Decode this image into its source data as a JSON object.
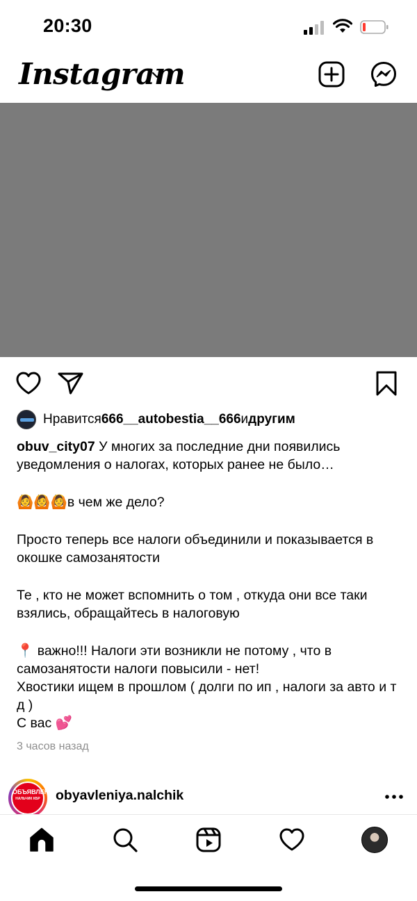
{
  "status_bar": {
    "time": "20:30"
  },
  "header": {
    "logo_text": "Instagram"
  },
  "post": {
    "likes": {
      "prefix": "Нравится ",
      "user": "666__autobestia__666",
      "middle": " и ",
      "suffix": "другим"
    },
    "caption": {
      "username": "obuv_city07",
      "line1": " У многих за последние дни появились уведомления о налогах, которых ранее не было…",
      "emoji_line": "🙆🙆🙆",
      "line2": "в чем же дело?",
      "para2": "Просто теперь все налоги объединили и показывается в окошке самозанятости",
      "para3": "Те , кто не может вспомнить о том , откуда они все таки взялись, обращайтесь в налоговую",
      "para4_emoji": "📍",
      "para4": " важно!!! Налоги эти возникли не потому , что в самозанятости налоги повысили - нет!",
      "para5": "Хвостики ищем в прошлом ( долги по ип , налоги за авто и т д )",
      "para6": "С вас ",
      "para6_emoji": "💕"
    },
    "timestamp": "3 часов назад"
  },
  "next_post": {
    "username": "obyavleniya.nalchik",
    "avatar_text_top": "ОБЪЯВЛЕНИЯ",
    "avatar_text_bottom": "НАЛЬЧИК КБР"
  },
  "colors": {
    "media_placeholder": "#7b7b7b",
    "secondary_text": "#8e8e8e",
    "battery_low": "#ff3b30",
    "avatar_red": "#e3001b"
  },
  "icons": {
    "header": [
      "plus-square-icon",
      "messenger-icon"
    ],
    "actions": [
      "heart-icon",
      "paper-plane-icon",
      "bookmark-icon"
    ],
    "tabs": [
      "home-icon",
      "search-icon",
      "reels-icon",
      "heart-icon",
      "avatar"
    ]
  }
}
